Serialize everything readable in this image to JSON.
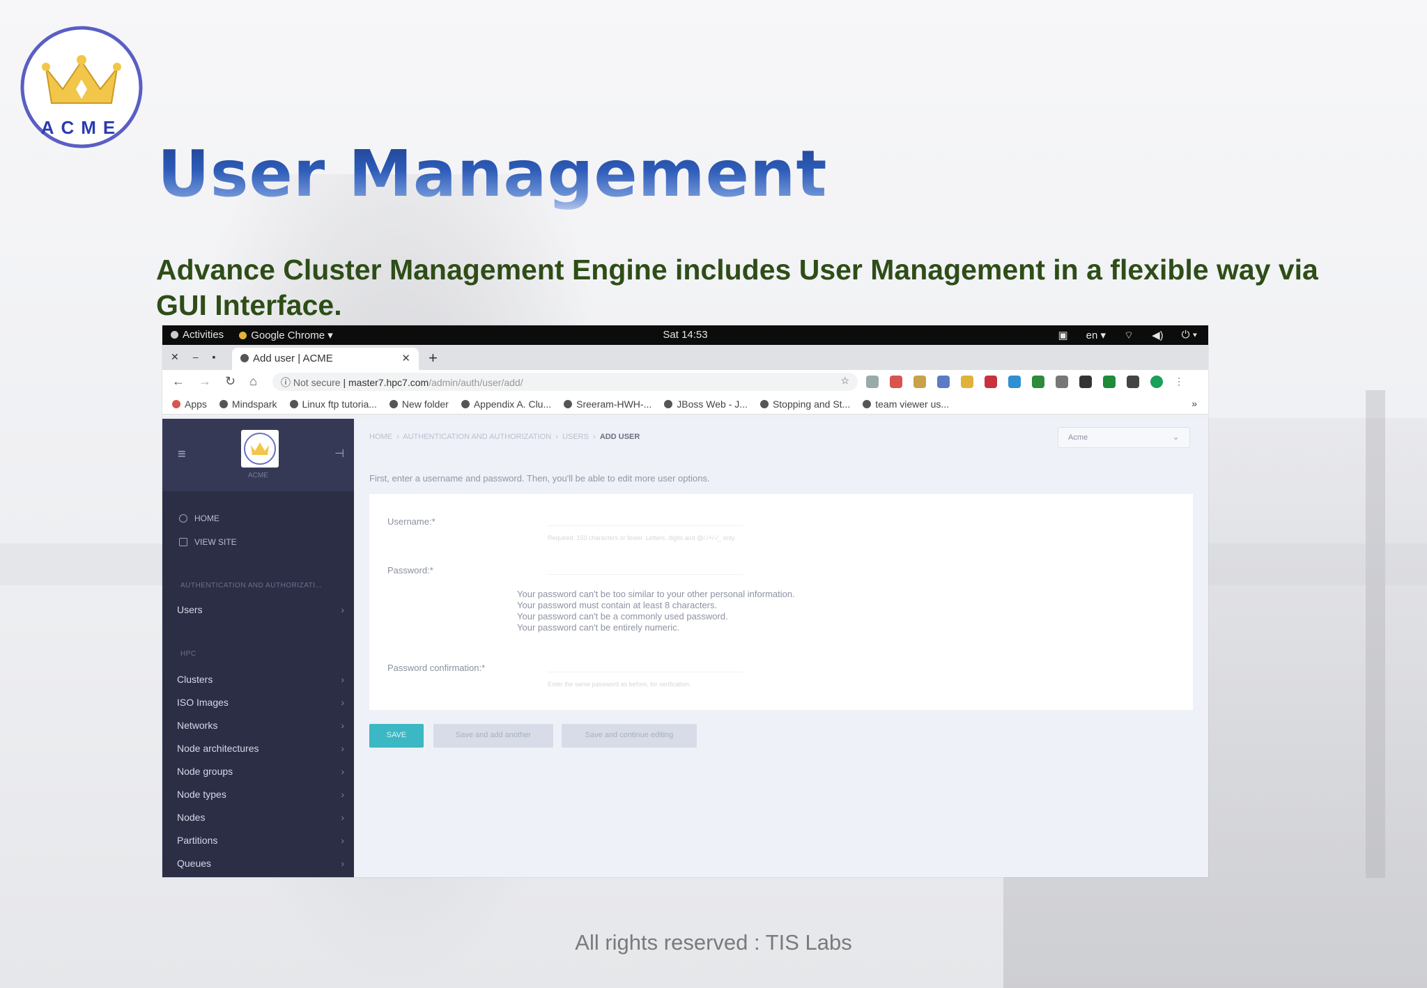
{
  "slide": {
    "title": "User Management",
    "subtitle": "Advance Cluster Management Engine includes User Management in a flexible way via GUI Interface.",
    "footer": "All rights reserved : TIS Labs",
    "logo_text": "ACME",
    "colors": {
      "title_blue": "#2e5cb8",
      "subtitle_green": "#2e4d17",
      "logo_ring": "#5a5fc4",
      "logo_crown": "#f2c64a"
    }
  },
  "os_bar": {
    "activities": "Activities",
    "app": "Google Chrome ▾",
    "clock": "Sat 14:53",
    "lang": "en ▾"
  },
  "browser": {
    "tab_title": "Add user | ACME",
    "url_security": "Not secure",
    "url_host": "master7.hpc7.com",
    "url_path": "/admin/auth/user/add/",
    "bookmarks": [
      "Apps",
      "Mindspark",
      "Linux ftp tutoria...",
      "New folder",
      "Appendix A. Clu...",
      "Sreeram-HWH-...",
      "JBoss Web - J...",
      "Stopping and St...",
      "team viewer us..."
    ],
    "more": "»"
  },
  "sidebar": {
    "logo_caption": "ACME",
    "home": "HOME",
    "view_site": "VIEW SITE",
    "section_auth": "AUTHENTICATION AND AUTHORIZATI...",
    "users": "Users",
    "section_hpc": "HPC",
    "items": [
      "Clusters",
      "ISO Images",
      "Networks",
      "Node architectures",
      "Node groups",
      "Node types",
      "Nodes",
      "Partitions",
      "Queues"
    ]
  },
  "content": {
    "breadcrumb": [
      "HOME",
      "AUTHENTICATION AND AUTHORIZATION",
      "USERS"
    ],
    "breadcrumb_current": "ADD USER",
    "site_select": "Acme",
    "intro": "First, enter a username and password. Then, you'll be able to edit more user options.",
    "username_label": "Username:*",
    "username_help": "Required. 150 characters or fewer. Letters, digits and @/./+/-/_ only.",
    "password_label": "Password:*",
    "password_help": [
      "Your password can't be too similar to your other personal information.",
      "Your password must contain at least 8 characters.",
      "Your password can't be a commonly used password.",
      "Your password can't be entirely numeric."
    ],
    "confirm_label": "Password confirmation:*",
    "confirm_help": "Enter the same password as before, for verification.",
    "save": "SAVE",
    "save_add": "Save and add another",
    "save_continue": "Save and continue editing"
  }
}
